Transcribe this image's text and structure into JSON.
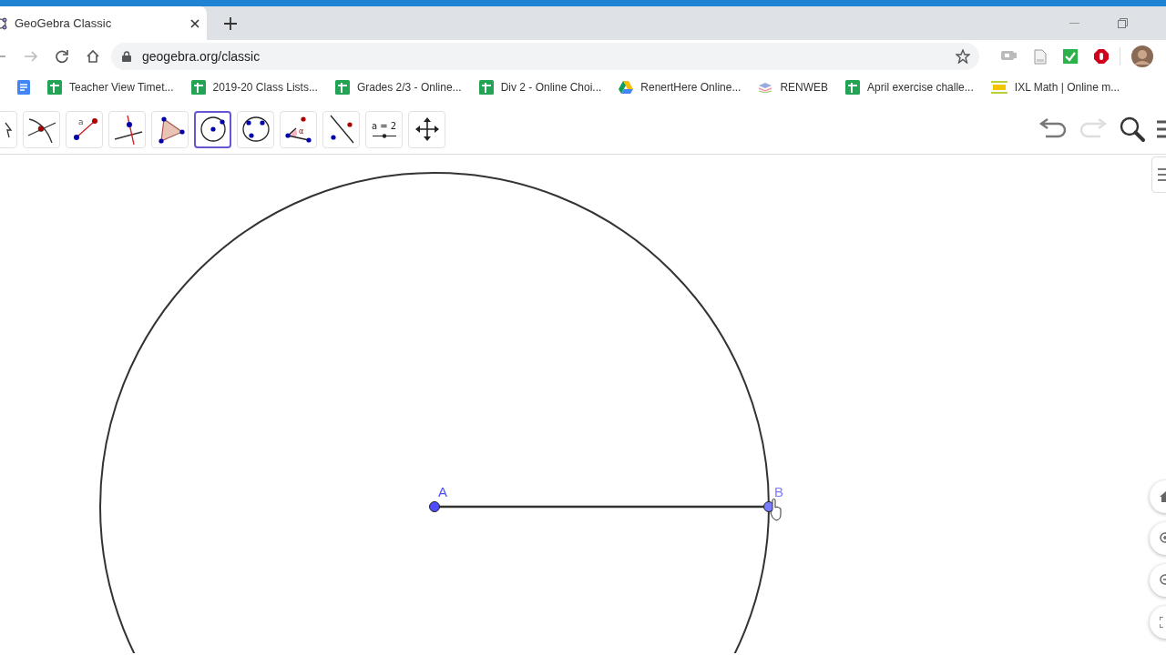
{
  "browser": {
    "tab": {
      "title": "GeoGebra Classic",
      "selected": true
    },
    "address": "geogebra.org/classic",
    "bookmarks": [
      {
        "kind": "docs"
      },
      {
        "kind": "sheets",
        "label": "Teacher View Timet..."
      },
      {
        "kind": "sheets",
        "label": "2019-20 Class Lists..."
      },
      {
        "kind": "sheets",
        "label": "Grades 2/3 - Online..."
      },
      {
        "kind": "sheets",
        "label": "Div 2 - Online Choi..."
      },
      {
        "kind": "drive",
        "label": "RenertHere Online..."
      },
      {
        "kind": "renweb",
        "label": "RENWEB"
      },
      {
        "kind": "sheets",
        "label": "April exercise challe..."
      },
      {
        "kind": "ixl",
        "label": "IXL Math | Online m..."
      }
    ]
  },
  "toolbar": {
    "tools": [
      {
        "kind": "move",
        "selected": false
      },
      {
        "kind": "intersect",
        "selected": false
      },
      {
        "kind": "segment",
        "selected": false,
        "label": "a"
      },
      {
        "kind": "perpendicular",
        "selected": false
      },
      {
        "kind": "polygon",
        "selected": false
      },
      {
        "kind": "circle",
        "selected": true
      },
      {
        "kind": "circle3",
        "selected": false
      },
      {
        "kind": "angle",
        "selected": false,
        "label": "α"
      },
      {
        "kind": "reflect",
        "selected": false
      },
      {
        "kind": "slider",
        "selected": false,
        "label": "a = 2"
      },
      {
        "kind": "pan",
        "selected": false
      }
    ],
    "redo_disabled": true
  },
  "canvas": {
    "points": [
      {
        "label": "A"
      },
      {
        "label": "B"
      }
    ]
  }
}
